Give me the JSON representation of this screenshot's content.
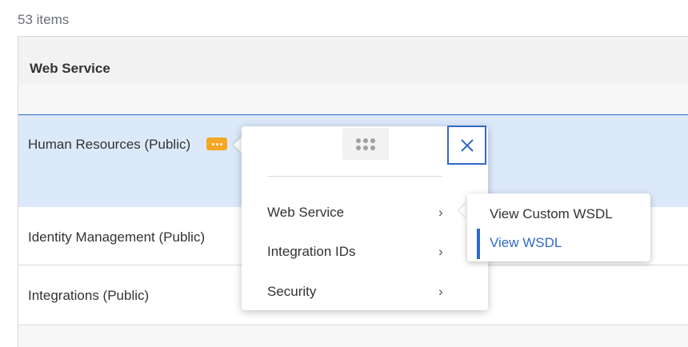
{
  "item_count": "53 items",
  "table": {
    "column_header": "Web Service",
    "rows": [
      {
        "label": "Human Resources (Public)"
      },
      {
        "label": "Identity Management (Public)"
      },
      {
        "label": "Integrations (Public)"
      }
    ]
  },
  "related_actions": {
    "menu": [
      {
        "label": "Web Service"
      },
      {
        "label": "Integration IDs"
      },
      {
        "label": "Security"
      }
    ],
    "submenu": [
      {
        "label": "View Custom WSDL"
      },
      {
        "label": "View WSDL"
      }
    ]
  },
  "icons": {
    "related_actions": "ellipsis-icon",
    "drag": "drag-handle-icon",
    "close": "close-icon",
    "chevron": "chevron-right-icon"
  },
  "colors": {
    "accent": "#2f6ac9",
    "selected_row": "#dce9fb",
    "related_button": "#f5a623"
  }
}
